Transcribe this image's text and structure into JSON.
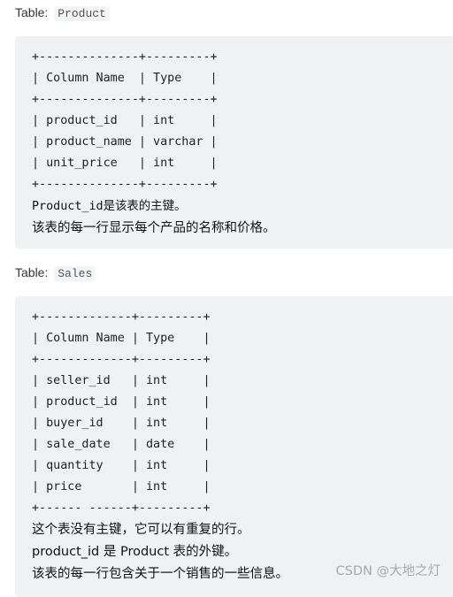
{
  "tables": [
    {
      "label_prefix": "Table:",
      "name": "Product",
      "ascii_lines": [
        "+--------------+---------+",
        "| Column Name  | Type    |",
        "+--------------+---------+",
        "| product_id   | int     |",
        "| product_name | varchar |",
        "| unit_price   | int     |",
        "+--------------+---------+"
      ],
      "columns_header": [
        "Column Name",
        "Type"
      ],
      "columns": [
        {
          "name": "product_id",
          "type": "int"
        },
        {
          "name": "product_name",
          "type": "varchar"
        },
        {
          "name": "unit_price",
          "type": "int"
        }
      ],
      "notes": [
        "Product_id是该表的主键。",
        "该表的每一行显示每个产品的名称和价格。"
      ]
    },
    {
      "label_prefix": "Table:",
      "name": "Sales",
      "ascii_lines": [
        "+-------------+---------+",
        "| Column Name | Type    |",
        "+-------------+---------+",
        "| seller_id   | int     |",
        "| product_id  | int     |",
        "| buyer_id    | int     |",
        "| sale_date   | date    |",
        "| quantity    | int     |",
        "| price       | int     |",
        "+------ ------+---------+"
      ],
      "columns_header": [
        "Column Name",
        "Type"
      ],
      "columns": [
        {
          "name": "seller_id",
          "type": "int"
        },
        {
          "name": "product_id",
          "type": "int"
        },
        {
          "name": "buyer_id",
          "type": "int"
        },
        {
          "name": "sale_date",
          "type": "date"
        },
        {
          "name": "quantity",
          "type": "int"
        },
        {
          "name": "price",
          "type": "int"
        }
      ],
      "notes": [
        "这个表没有主键，它可以有重复的行。",
        "product_id 是 Product 表的外键。",
        "该表的每一行包含关于一个销售的一些信息。"
      ]
    }
  ],
  "watermark": "CSDN @大地之灯"
}
